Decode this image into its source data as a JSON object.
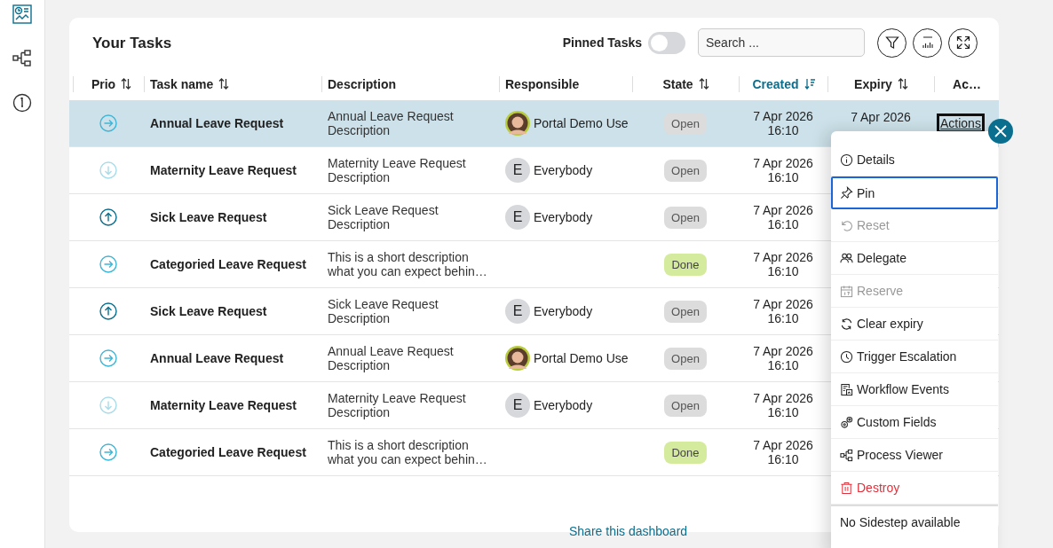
{
  "sidebar": {
    "items": [
      {
        "selected": true
      },
      {
        "selected": false
      },
      {
        "selected": false
      }
    ]
  },
  "card": {
    "title": "Your Tasks",
    "pinned_toggle": {
      "label": "Pinned Tasks",
      "on": false
    },
    "search": {
      "placeholder": "Search ..."
    }
  },
  "table": {
    "columns": [
      {
        "label": "Prio",
        "sortable": true,
        "sorted": false
      },
      {
        "label": "Task name",
        "sortable": true,
        "sorted": false
      },
      {
        "label": "Description",
        "sortable": false,
        "sorted": false
      },
      {
        "label": "Responsible",
        "sortable": false,
        "sorted": false
      },
      {
        "label": "State",
        "sortable": true,
        "sorted": false
      },
      {
        "label": "Created",
        "sortable": true,
        "sorted": true
      },
      {
        "label": "Expiry",
        "sortable": true,
        "sorted": false
      },
      {
        "label": "Ac…",
        "sortable": false,
        "sorted": false
      }
    ],
    "rows": [
      {
        "selected": true,
        "kind": "normal",
        "name": "Annual Leave Request",
        "description": "Annual Leave Request Description",
        "responsible": {
          "kind": "photo",
          "name": "Portal Demo Use"
        },
        "state": {
          "kind": "open",
          "label": "Open"
        },
        "created": [
          "7 Apr 2026",
          "16:10"
        ],
        "expiry": [
          "7 Apr 2026"
        ],
        "actions": "Actions"
      },
      {
        "selected": false,
        "kind": "low",
        "name": "Maternity Leave Request",
        "description": "Maternity Leave Request Description",
        "responsible": {
          "kind": "initial",
          "initial": "E",
          "name": "Everybody"
        },
        "state": {
          "kind": "open",
          "label": "Open"
        },
        "created": [
          "7 Apr 2026",
          "16:10"
        ]
      },
      {
        "selected": false,
        "kind": "high",
        "name": "Sick Leave Request",
        "description": "Sick Leave Request Description",
        "responsible": {
          "kind": "initial",
          "initial": "E",
          "name": "Everybody"
        },
        "state": {
          "kind": "open",
          "label": "Open"
        },
        "created": [
          "7 Apr 2026",
          "16:10"
        ]
      },
      {
        "selected": false,
        "kind": "normal",
        "name": "Categoried Leave Request",
        "description": "This is a short description what you can expect behin…",
        "state": {
          "kind": "done",
          "label": "Done"
        },
        "created": [
          "7 Apr 2026",
          "16:10"
        ]
      },
      {
        "selected": false,
        "kind": "high",
        "name": "Sick Leave Request",
        "description": "Sick Leave Request Description",
        "responsible": {
          "kind": "initial",
          "initial": "E",
          "name": "Everybody"
        },
        "state": {
          "kind": "open",
          "label": "Open"
        },
        "created": [
          "7 Apr 2026",
          "16:10"
        ]
      },
      {
        "selected": false,
        "kind": "normal",
        "name": "Annual Leave Request",
        "description": "Annual Leave Request Description",
        "responsible": {
          "kind": "photo",
          "name": "Portal Demo Use"
        },
        "state": {
          "kind": "open",
          "label": "Open"
        },
        "created": [
          "7 Apr 2026",
          "16:10"
        ]
      },
      {
        "selected": false,
        "kind": "low",
        "name": "Maternity Leave Request",
        "description": "Maternity Leave Request Description",
        "responsible": {
          "kind": "initial",
          "initial": "E",
          "name": "Everybody"
        },
        "state": {
          "kind": "open",
          "label": "Open"
        },
        "created": [
          "7 Apr 2026",
          "16:10"
        ]
      },
      {
        "selected": false,
        "kind": "normal",
        "name": "Categoried Leave Request",
        "description": "This is a short description what you can expect behin…",
        "state": {
          "kind": "done",
          "label": "Done"
        },
        "created": [
          "7 Apr 2026",
          "16:10"
        ]
      }
    ]
  },
  "actions_menu": {
    "items": [
      {
        "label": "Details",
        "disabled": false,
        "selected": false,
        "kind": "normal"
      },
      {
        "label": "Pin",
        "disabled": false,
        "selected": true,
        "kind": "normal"
      },
      {
        "label": "Reset",
        "disabled": true,
        "selected": false,
        "kind": "normal"
      },
      {
        "label": "Delegate",
        "disabled": false,
        "selected": false,
        "kind": "normal"
      },
      {
        "label": "Reserve",
        "disabled": true,
        "selected": false,
        "kind": "normal"
      },
      {
        "label": "Clear expiry",
        "disabled": false,
        "selected": false,
        "kind": "normal"
      },
      {
        "label": "Trigger Escalation",
        "disabled": false,
        "selected": false,
        "kind": "normal"
      },
      {
        "label": "Workflow Events",
        "disabled": false,
        "selected": false,
        "kind": "normal"
      },
      {
        "label": "Custom Fields",
        "disabled": false,
        "selected": false,
        "kind": "normal"
      },
      {
        "label": "Process Viewer",
        "disabled": false,
        "selected": false,
        "kind": "normal"
      },
      {
        "label": "Destroy",
        "disabled": false,
        "selected": false,
        "kind": "danger"
      }
    ],
    "footer": "No Sidestep available"
  },
  "share_link": "Share this dashboard"
}
